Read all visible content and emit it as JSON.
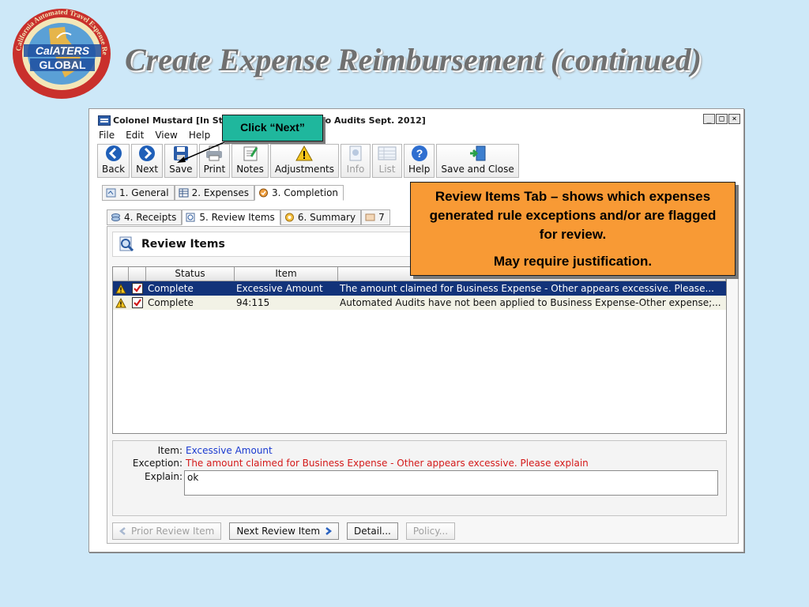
{
  "slide": {
    "title": "Create Expense Reimbursement (continued)",
    "logo": {
      "arc_text": "California Automated Travel Expense Reimbursement System",
      "text_top": "CalATERS",
      "text_bottom": "GLOBAL"
    }
  },
  "window": {
    "title": "Colonel  Mustard [In St",
    "title_tail": "o Audits Sept. 2012]",
    "controls": [
      "_",
      "□",
      "×"
    ]
  },
  "menu": [
    "File",
    "Edit",
    "View",
    "Help"
  ],
  "toolbar": [
    {
      "label": "Back",
      "icon": "back-arrow-icon",
      "enabled": true
    },
    {
      "label": "Next",
      "icon": "next-arrow-icon",
      "enabled": true
    },
    {
      "label": "Save",
      "icon": "save-disk-icon",
      "enabled": true
    },
    {
      "label": "Print",
      "icon": "printer-icon",
      "enabled": true
    },
    {
      "label": "Notes",
      "icon": "notes-icon",
      "enabled": true
    },
    {
      "label": "Adjustments",
      "icon": "warning-icon",
      "enabled": true
    },
    {
      "label": "Info",
      "icon": "info-icon",
      "enabled": false
    },
    {
      "label": "List",
      "icon": "list-icon",
      "enabled": false
    },
    {
      "label": "Help",
      "icon": "help-icon",
      "enabled": true
    },
    {
      "label": "Save and Close",
      "icon": "save-close-icon",
      "enabled": true
    }
  ],
  "tabs_row1": [
    {
      "label": "1. General",
      "active": false
    },
    {
      "label": "2. Expenses",
      "active": false
    },
    {
      "label": "3. Completion",
      "active": true
    }
  ],
  "tabs_row2": [
    {
      "label": "4. Receipts",
      "active": false
    },
    {
      "label": "5. Review Items",
      "active": true
    },
    {
      "label": "6. Summary",
      "active": false
    },
    {
      "label": "7",
      "active": false
    }
  ],
  "section": {
    "title": "Review Items"
  },
  "grid": {
    "headers": [
      "",
      "",
      "Status",
      "Item",
      ""
    ],
    "rows": [
      {
        "status": "Complete",
        "item": "Excessive Amount",
        "description": "The amount claimed for Business Expense - Other appears excessive.  Please...",
        "selected": true
      },
      {
        "status": "Complete",
        "item": "94:115",
        "description": "Automated Audits have not been applied to Business Expense-Other expense;...",
        "selected": false
      }
    ]
  },
  "detail": {
    "item_label": "Item:",
    "item_value": "Excessive Amount",
    "exception_label": "Exception:",
    "exception_value": "The amount claimed for Business Expense - Other appears excessive.  Please explain",
    "explain_label": "Explain:",
    "explain_value": "ok"
  },
  "bottom_buttons": [
    {
      "label": "Prior Review Item",
      "enabled": false
    },
    {
      "label": "Next Review Item",
      "enabled": true
    },
    {
      "label": "Detail...",
      "enabled": true
    },
    {
      "label": "Policy...",
      "enabled": false
    }
  ],
  "callouts": {
    "next": "Click  “Next”",
    "review_line1": "Review Items Tab – shows which expenses generated rule exceptions and/or are flagged for review.",
    "review_line2": "May require justification."
  },
  "colors": {
    "background": "#cde8f8",
    "callout_next": "#1fb79d",
    "callout_review": "#f89a35",
    "selected_row": "#12337a",
    "detail_item": "#1a3ad0",
    "detail_exception": "#d41a1a"
  }
}
